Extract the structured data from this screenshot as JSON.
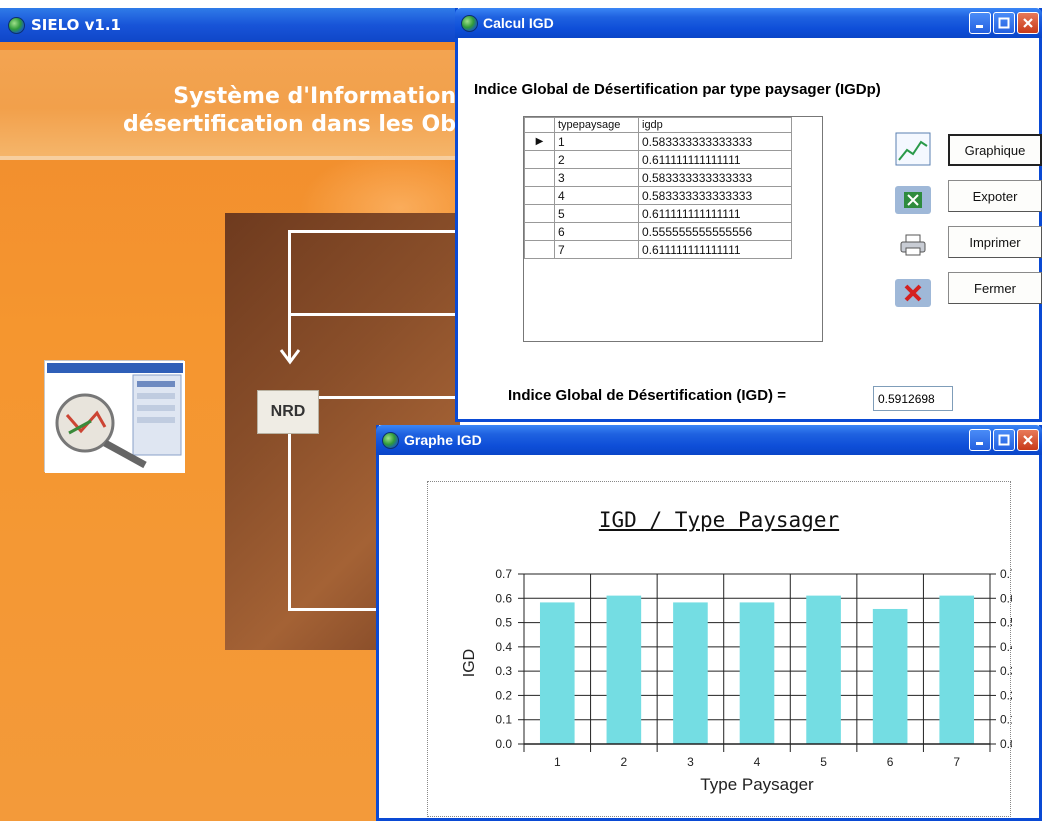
{
  "sielo": {
    "title": "SIELO v1.1",
    "banner_line1": "Système d'Information",
    "banner_line2": "désertification dans les Ob",
    "node_label": "NRD"
  },
  "calc": {
    "title": "Calcul IGD",
    "heading": "Indice Global de Désertification par type paysager (IGDp)",
    "columns": [
      "typepaysage",
      "igdp"
    ],
    "rows": [
      [
        "1",
        "0.583333333333333"
      ],
      [
        "2",
        "0.611111111111111"
      ],
      [
        "3",
        "0.583333333333333"
      ],
      [
        "4",
        "0.583333333333333"
      ],
      [
        "5",
        "0.611111111111111"
      ],
      [
        "6",
        "0.555555555555556"
      ],
      [
        "7",
        "0.611111111111111"
      ]
    ],
    "buttons": {
      "graphique": "Graphique",
      "exporter": "Expoter",
      "imprimer": "Imprimer",
      "fermer": "Fermer"
    },
    "igd_label": "Indice Global de Désertification (IGD) =",
    "igd_value": "0.5912698"
  },
  "graphe": {
    "title": "Graphe IGD"
  },
  "chart_data": {
    "type": "bar",
    "title": "IGD / Type Paysager",
    "xlabel": "Type Paysager",
    "ylabel": "IGD",
    "categories": [
      "1",
      "2",
      "3",
      "4",
      "5",
      "6",
      "7"
    ],
    "values": [
      0.583,
      0.611,
      0.583,
      0.583,
      0.611,
      0.556,
      0.611
    ],
    "ylim": [
      0,
      0.7
    ],
    "yticks": [
      "0.0",
      "0.1",
      "0.2",
      "0.3",
      "0.4",
      "0.5",
      "0.6",
      "0.7"
    ],
    "grid": true,
    "bar_color": "#74dde3"
  }
}
